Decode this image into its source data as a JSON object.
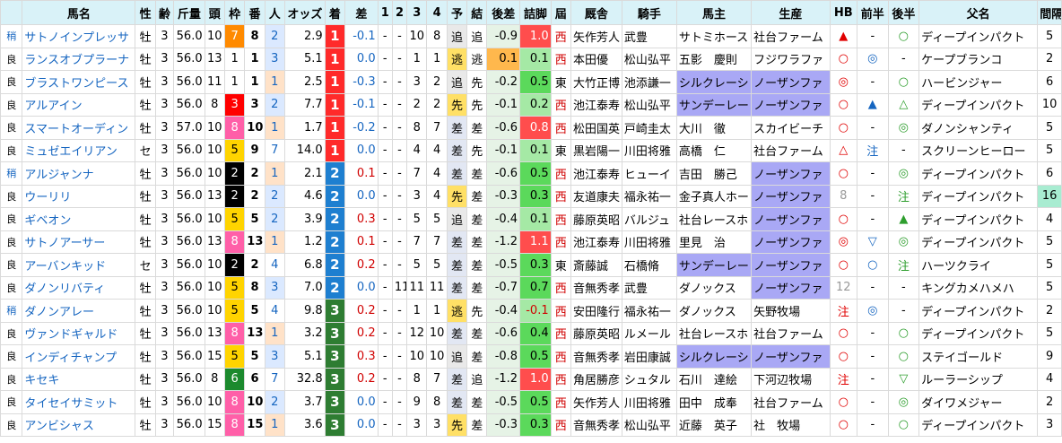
{
  "headers": [
    "",
    "馬名",
    "性",
    "齢",
    "斤量",
    "頭",
    "枠",
    "番",
    "人",
    "オッズ",
    "着",
    "差",
    "1",
    "2",
    "3",
    "4",
    "予",
    "結",
    "後差",
    "詰脚",
    "屆",
    "厩舎",
    "騎手",
    "馬主",
    "生産",
    "HB",
    "前半",
    "後半",
    "父名",
    "間隔"
  ],
  "rows": [
    {
      "baba": "稍",
      "name": "サトノインプレッサ",
      "sex": "牡",
      "age": "3",
      "kinryo": "56.0",
      "to": "10",
      "waku": "7",
      "ban": "8",
      "nin": "2",
      "odds": "2.9",
      "chaku": "1",
      "sa": "-0.1",
      "c1": "-",
      "c2": "-",
      "c3": "10",
      "c4": "8",
      "yo": "追",
      "ke": "追",
      "kosa": "-0.9",
      "tsume": "1.0",
      "tozai": "西",
      "kyusha": "矢作芳人",
      "kishu": "武豊",
      "banushi": "サトミホース",
      "seisan": "社台ファーム",
      "hb": "▲",
      "zen": "-",
      "kou": "○",
      "chichi": "ディープインパクト",
      "kankaku": "5"
    },
    {
      "baba": "良",
      "name": "ランスオブプラーナ",
      "sex": "牡",
      "age": "3",
      "kinryo": "56.0",
      "to": "13",
      "waku": "1",
      "ban": "1",
      "nin": "3",
      "odds": "5.1",
      "chaku": "1",
      "sa": "0.0",
      "c1": "-",
      "c2": "-",
      "c3": "1",
      "c4": "1",
      "yo": "逃",
      "ke": "逃",
      "kosa": "0.1",
      "tsume": "0.1",
      "tozai": "西",
      "kyusha": "本田優",
      "kishu": "松山弘平",
      "banushi": "五影　慶則",
      "seisan": "フジワラファ",
      "hb": "○",
      "zen": "◎",
      "kou": "-",
      "chichi": "ケープブランコ",
      "kankaku": "2"
    },
    {
      "baba": "良",
      "name": "ブラストワンピース",
      "sex": "牡",
      "age": "3",
      "kinryo": "56.0",
      "to": "11",
      "waku": "1",
      "ban": "1",
      "nin": "1",
      "odds": "2.5",
      "chaku": "1",
      "sa": "-0.3",
      "c1": "-",
      "c2": "-",
      "c3": "3",
      "c4": "2",
      "yo": "追",
      "ke": "先",
      "kosa": "-0.2",
      "tsume": "0.5",
      "tozai": "東",
      "kyusha": "大竹正博",
      "kishu": "池添謙一",
      "banushi": "シルクレーシ",
      "seisan": "ノーザンファ",
      "hb": "◎",
      "zen": "-",
      "kou": "○",
      "chichi": "ハービンジャー",
      "kankaku": "6"
    },
    {
      "baba": "良",
      "name": "アルアイン",
      "sex": "牡",
      "age": "3",
      "kinryo": "56.0",
      "to": "8",
      "waku": "3",
      "ban": "3",
      "nin": "2",
      "odds": "7.7",
      "chaku": "1",
      "sa": "-0.1",
      "c1": "-",
      "c2": "-",
      "c3": "2",
      "c4": "2",
      "yo": "先",
      "ke": "先",
      "kosa": "-0.1",
      "tsume": "0.2",
      "tozai": "西",
      "kyusha": "池江泰寿",
      "kishu": "松山弘平",
      "banushi": "サンデーレー",
      "seisan": "ノーザンファ",
      "hb": "○",
      "zen": "▲",
      "kou": "△",
      "chichi": "ディープインパクト",
      "kankaku": "10"
    },
    {
      "baba": "良",
      "name": "スマートオーディン",
      "sex": "牡",
      "age": "3",
      "kinryo": "57.0",
      "to": "10",
      "waku": "8",
      "ban": "10",
      "nin": "1",
      "odds": "1.7",
      "chaku": "1",
      "sa": "-0.2",
      "c1": "-",
      "c2": "-",
      "c3": "8",
      "c4": "7",
      "yo": "差",
      "ke": "差",
      "kosa": "-0.6",
      "tsume": "0.8",
      "tozai": "西",
      "kyusha": "松田国英",
      "kishu": "戸崎圭太",
      "banushi": "大川　徹",
      "seisan": "スカイビーチ",
      "hb": "○",
      "zen": "-",
      "kou": "◎",
      "chichi": "ダノンシャンティ",
      "kankaku": "5"
    },
    {
      "baba": "良",
      "name": "ミュゼエイリアン",
      "sex": "セ",
      "age": "3",
      "kinryo": "56.0",
      "to": "10",
      "waku": "5",
      "ban": "9",
      "nin": "7",
      "odds": "14.0",
      "chaku": "1",
      "sa": "0.0",
      "c1": "-",
      "c2": "-",
      "c3": "4",
      "c4": "4",
      "yo": "差",
      "ke": "先",
      "kosa": "-0.1",
      "tsume": "0.1",
      "tozai": "東",
      "kyusha": "黒岩陽一",
      "kishu": "川田将雅",
      "banushi": "高橋　仁",
      "seisan": "社台ファーム",
      "hb": "△",
      "zen": "注",
      "kou": "-",
      "chichi": "スクリーンヒーロー",
      "kankaku": "5"
    },
    {
      "baba": "稍",
      "name": "アルジャンナ",
      "sex": "牡",
      "age": "3",
      "kinryo": "56.0",
      "to": "10",
      "waku": "2",
      "ban": "2",
      "nin": "1",
      "odds": "2.1",
      "chaku": "2",
      "sa": "0.1",
      "c1": "-",
      "c2": "-",
      "c3": "7",
      "c4": "4",
      "yo": "差",
      "ke": "差",
      "kosa": "-0.6",
      "tsume": "0.5",
      "tozai": "西",
      "kyusha": "池江泰寿",
      "kishu": "ヒューイ",
      "banushi": "吉田　勝己",
      "seisan": "ノーザンファ",
      "hb": "○",
      "zen": "-",
      "kou": "◎",
      "chichi": "ディープインパクト",
      "kankaku": "6"
    },
    {
      "baba": "良",
      "name": "ウーリリ",
      "sex": "牡",
      "age": "3",
      "kinryo": "56.0",
      "to": "13",
      "waku": "2",
      "ban": "2",
      "nin": "2",
      "odds": "4.6",
      "chaku": "2",
      "sa": "0.0",
      "c1": "-",
      "c2": "-",
      "c3": "3",
      "c4": "4",
      "yo": "先",
      "ke": "差",
      "kosa": "-0.3",
      "tsume": "0.3",
      "tozai": "西",
      "kyusha": "友道康夫",
      "kishu": "福永祐一",
      "banushi": "金子真人ホー",
      "seisan": "ノーザンファ",
      "hb": "8",
      "zen": "-",
      "kou": "注",
      "chichi": "ディープインパクト",
      "kankaku": "16"
    },
    {
      "baba": "良",
      "name": "ギベオン",
      "sex": "牡",
      "age": "3",
      "kinryo": "56.0",
      "to": "10",
      "waku": "5",
      "ban": "5",
      "nin": "2",
      "odds": "3.9",
      "chaku": "2",
      "sa": "0.3",
      "c1": "-",
      "c2": "-",
      "c3": "5",
      "c4": "5",
      "yo": "追",
      "ke": "差",
      "kosa": "-0.4",
      "tsume": "0.1",
      "tozai": "西",
      "kyusha": "藤原英昭",
      "kishu": "バルジュ",
      "banushi": "社台レースホ",
      "seisan": "ノーザンファ",
      "hb": "○",
      "zen": "-",
      "kou": "▲",
      "chichi": "ディープインパクト",
      "kankaku": "4"
    },
    {
      "baba": "良",
      "name": "サトノアーサー",
      "sex": "牡",
      "age": "3",
      "kinryo": "56.0",
      "to": "13",
      "waku": "8",
      "ban": "13",
      "nin": "1",
      "odds": "1.2",
      "chaku": "2",
      "sa": "0.1",
      "c1": "-",
      "c2": "-",
      "c3": "7",
      "c4": "7",
      "yo": "差",
      "ke": "差",
      "kosa": "-1.2",
      "tsume": "1.1",
      "tozai": "西",
      "kyusha": "池江泰寿",
      "kishu": "川田将雅",
      "banushi": "里見　治",
      "seisan": "ノーザンファ",
      "hb": "◎",
      "zen": "▽",
      "kou": "◎",
      "chichi": "ディープインパクト",
      "kankaku": "5"
    },
    {
      "baba": "良",
      "name": "アーバンキッド",
      "sex": "セ",
      "age": "3",
      "kinryo": "56.0",
      "to": "10",
      "waku": "2",
      "ban": "2",
      "nin": "4",
      "odds": "6.8",
      "chaku": "2",
      "sa": "0.2",
      "c1": "-",
      "c2": "-",
      "c3": "5",
      "c4": "5",
      "yo": "差",
      "ke": "差",
      "kosa": "-0.5",
      "tsume": "0.3",
      "tozai": "東",
      "kyusha": "斎藤誠",
      "kishu": "石橋脩",
      "banushi": "サンデーレー",
      "seisan": "ノーザンファ",
      "hb": "○",
      "zen": "○",
      "kou": "注",
      "chichi": "ハーツクライ",
      "kankaku": "5"
    },
    {
      "baba": "良",
      "name": "ダノンリバティ",
      "sex": "牡",
      "age": "3",
      "kinryo": "56.0",
      "to": "10",
      "waku": "5",
      "ban": "8",
      "nin": "3",
      "odds": "7.0",
      "chaku": "2",
      "sa": "0.0",
      "c1": "-",
      "c2": "11",
      "c3": "11",
      "c4": "11",
      "yo": "差",
      "ke": "差",
      "kosa": "-0.7",
      "tsume": "0.7",
      "tozai": "西",
      "kyusha": "音無秀孝",
      "kishu": "武豊",
      "banushi": "ダノックス",
      "seisan": "ノーザンファ",
      "hb": "12",
      "zen": "-",
      "kou": "-",
      "chichi": "キングカメハメハ",
      "kankaku": "5"
    },
    {
      "baba": "稍",
      "name": "ダノンアレー",
      "sex": "牡",
      "age": "3",
      "kinryo": "56.0",
      "to": "10",
      "waku": "5",
      "ban": "5",
      "nin": "4",
      "odds": "9.8",
      "chaku": "3",
      "sa": "0.2",
      "c1": "-",
      "c2": "-",
      "c3": "1",
      "c4": "1",
      "yo": "逃",
      "ke": "先",
      "kosa": "-0.4",
      "tsume": "-0.1",
      "tozai": "西",
      "kyusha": "安田隆行",
      "kishu": "福永祐一",
      "banushi": "ダノックス",
      "seisan": "矢野牧場",
      "hb": "注",
      "zen": "◎",
      "kou": "-",
      "chichi": "ディープインパクト",
      "kankaku": "2"
    },
    {
      "baba": "良",
      "name": "ヴァンドギャルド",
      "sex": "牡",
      "age": "3",
      "kinryo": "56.0",
      "to": "13",
      "waku": "8",
      "ban": "13",
      "nin": "1",
      "odds": "3.2",
      "chaku": "3",
      "sa": "0.2",
      "c1": "-",
      "c2": "-",
      "c3": "12",
      "c4": "10",
      "yo": "差",
      "ke": "差",
      "kosa": "-0.6",
      "tsume": "0.4",
      "tozai": "西",
      "kyusha": "藤原英昭",
      "kishu": "ルメール",
      "banushi": "社台レースホ",
      "seisan": "社台ファーム",
      "hb": "○",
      "zen": "-",
      "kou": "○",
      "chichi": "ディープインパクト",
      "kankaku": "5"
    },
    {
      "baba": "良",
      "name": "インディチャンプ",
      "sex": "牡",
      "age": "3",
      "kinryo": "56.0",
      "to": "15",
      "waku": "5",
      "ban": "5",
      "nin": "3",
      "odds": "5.1",
      "chaku": "3",
      "sa": "0.3",
      "c1": "-",
      "c2": "-",
      "c3": "10",
      "c4": "10",
      "yo": "追",
      "ke": "差",
      "kosa": "-0.8",
      "tsume": "0.5",
      "tozai": "西",
      "kyusha": "音無秀孝",
      "kishu": "岩田康誠",
      "banushi": "シルクレーシ",
      "seisan": "ノーザンファ",
      "hb": "○",
      "zen": "-",
      "kou": "○",
      "chichi": "ステイゴールド",
      "kankaku": "9"
    },
    {
      "baba": "良",
      "name": "キセキ",
      "sex": "牡",
      "age": "3",
      "kinryo": "56.0",
      "to": "8",
      "waku": "6",
      "ban": "6",
      "nin": "7",
      "odds": "32.8",
      "chaku": "3",
      "sa": "0.2",
      "c1": "-",
      "c2": "-",
      "c3": "8",
      "c4": "7",
      "yo": "差",
      "ke": "追",
      "kosa": "-1.2",
      "tsume": "1.0",
      "tozai": "西",
      "kyusha": "角居勝彦",
      "kishu": "シュタル",
      "banushi": "石川　達絵",
      "seisan": "下河辺牧場",
      "hb": "注",
      "zen": "-",
      "kou": "▽",
      "chichi": "ルーラーシップ",
      "kankaku": "4"
    },
    {
      "baba": "良",
      "name": "タイセイサミット",
      "sex": "牡",
      "age": "3",
      "kinryo": "56.0",
      "to": "10",
      "waku": "8",
      "ban": "10",
      "nin": "2",
      "odds": "3.7",
      "chaku": "3",
      "sa": "0.0",
      "c1": "-",
      "c2": "-",
      "c3": "9",
      "c4": "8",
      "yo": "差",
      "ke": "差",
      "kosa": "-0.5",
      "tsume": "0.5",
      "tozai": "西",
      "kyusha": "矢作芳人",
      "kishu": "川田将雅",
      "banushi": "田中　成奉",
      "seisan": "社台ファーム",
      "hb": "○",
      "zen": "-",
      "kou": "◎",
      "chichi": "ダイワメジャー",
      "kankaku": "2"
    },
    {
      "baba": "良",
      "name": "アンビシャス",
      "sex": "牡",
      "age": "3",
      "kinryo": "56.0",
      "to": "15",
      "waku": "8",
      "ban": "15",
      "nin": "1",
      "odds": "3.6",
      "chaku": "3",
      "sa": "0.0",
      "c1": "-",
      "c2": "-",
      "c3": "3",
      "c4": "3",
      "yo": "先",
      "ke": "差",
      "kosa": "-0.3",
      "tsume": "0.3",
      "tozai": "西",
      "kyusha": "音無秀孝",
      "kishu": "松山弘平",
      "banushi": "近藤　英子",
      "seisan": "社　牧場",
      "hb": "○",
      "zen": "-",
      "kou": "○",
      "chichi": "ディープインパクト",
      "kankaku": "3"
    }
  ],
  "colors": {
    "header_bg": "#d9f2f8",
    "name_link": "#1565c0",
    "first": "#ff2a2a",
    "second": "#1e7fd0",
    "third": "#2e7d32"
  }
}
